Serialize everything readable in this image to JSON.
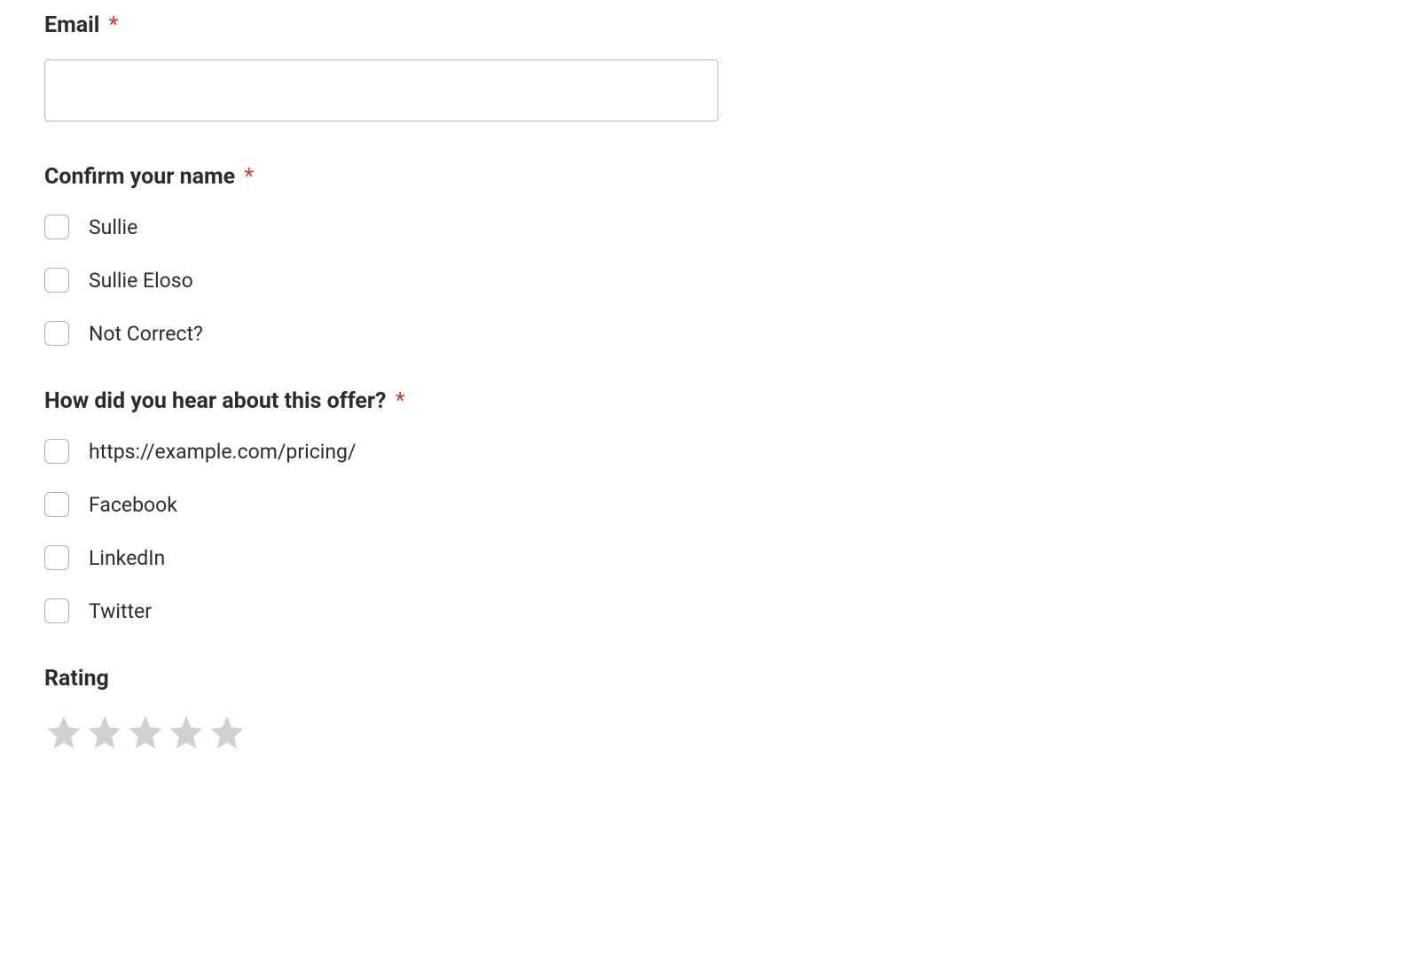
{
  "fields": {
    "email": {
      "label": "Email",
      "required": true,
      "value": ""
    },
    "confirm_name": {
      "label": "Confirm your name",
      "required": true,
      "options": [
        "Sullie",
        "Sullie Eloso",
        "Not Correct?"
      ]
    },
    "hear_about": {
      "label": "How did you hear about this offer?",
      "required": true,
      "options": [
        "https://example.com/pricing/",
        "Facebook",
        "LinkedIn",
        "Twitter"
      ]
    },
    "rating": {
      "label": "Rating",
      "required": false,
      "max_stars": 5,
      "value": 0
    }
  },
  "required_marker": "*"
}
